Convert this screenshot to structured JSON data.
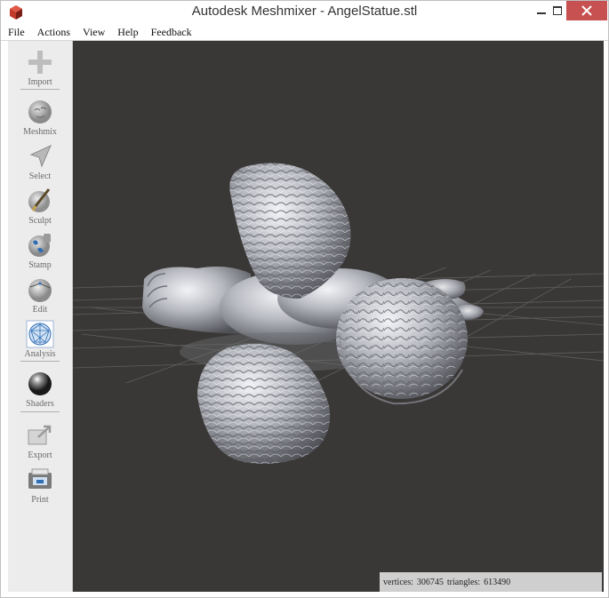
{
  "window": {
    "title": "Autodesk Meshmixer - AngelStatue.stl"
  },
  "menu": {
    "items": [
      "File",
      "Actions",
      "View",
      "Help",
      "Feedback"
    ]
  },
  "toolbar": {
    "items": [
      {
        "label": "Import",
        "icon": "plus-icon"
      },
      {
        "label": "Meshmix",
        "icon": "meshmix-icon"
      },
      {
        "label": "Select",
        "icon": "select-arrow-icon"
      },
      {
        "label": "Sculpt",
        "icon": "sculpt-brush-icon"
      },
      {
        "label": "Stamp",
        "icon": "stamp-icon"
      },
      {
        "label": "Edit",
        "icon": "edit-sphere-icon"
      },
      {
        "label": "Analysis",
        "icon": "analysis-icon"
      },
      {
        "label": "Shaders",
        "icon": "shader-ball-icon"
      },
      {
        "label": "Export",
        "icon": "export-icon"
      },
      {
        "label": "Print",
        "icon": "print-icon"
      }
    ]
  },
  "viewport": {
    "background": "#3a3836",
    "model": "angel statue mesh"
  },
  "status": {
    "vertices_label": "vertices:",
    "vertices": "306745",
    "triangles_label": "triangles:",
    "triangles": "613490"
  }
}
